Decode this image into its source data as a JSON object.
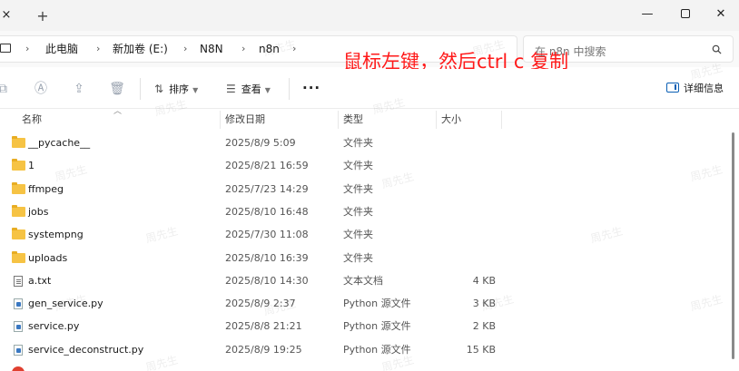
{
  "window": {
    "close_tab_glyph": "×",
    "new_tab_glyph": "+",
    "minimize_glyph": "—",
    "close_glyph": "✕"
  },
  "address": {
    "breadcrumbs": [
      "此电脑",
      "新加卷 (E:)",
      "N8N",
      "n8n"
    ],
    "separator": "›"
  },
  "search": {
    "placeholder": "在 n8n 中搜索"
  },
  "annotation": {
    "text": "鼠标左键，然后ctrl c 复制",
    "color": "#ff1a1a"
  },
  "toolbar": {
    "sort_label": "排序",
    "view_label": "查看",
    "more_label": "···",
    "details_label": "详细信息"
  },
  "columns": {
    "name": "名称",
    "date": "修改日期",
    "type": "类型",
    "size": "大小"
  },
  "files": [
    {
      "icon": "folder-icon",
      "name": "__pycache__",
      "date": "2025/8/9 5:09",
      "type": "文件夹",
      "size": ""
    },
    {
      "icon": "folder-icon",
      "name": "1",
      "date": "2025/8/21 16:59",
      "type": "文件夹",
      "size": ""
    },
    {
      "icon": "folder-icon",
      "name": "ffmpeg",
      "date": "2025/7/23 14:29",
      "type": "文件夹",
      "size": ""
    },
    {
      "icon": "folder-icon",
      "name": "jobs",
      "date": "2025/8/10 16:48",
      "type": "文件夹",
      "size": ""
    },
    {
      "icon": "folder-icon",
      "name": "systempng",
      "date": "2025/7/30 11:08",
      "type": "文件夹",
      "size": ""
    },
    {
      "icon": "folder-icon",
      "name": "uploads",
      "date": "2025/8/10 16:39",
      "type": "文件夹",
      "size": ""
    },
    {
      "icon": "text-file-icon",
      "name": "a.txt",
      "date": "2025/8/10 14:30",
      "type": "文本文档",
      "size": "4 KB"
    },
    {
      "icon": "python-file-icon",
      "name": "gen_service.py",
      "date": "2025/8/9 2:37",
      "type": "Python 源文件",
      "size": "3 KB"
    },
    {
      "icon": "python-file-icon",
      "name": "service.py",
      "date": "2025/8/8 21:21",
      "type": "Python 源文件",
      "size": "2 KB"
    },
    {
      "icon": "python-file-icon",
      "name": "service_deconstruct.py",
      "date": "2025/8/9 19:25",
      "type": "Python 源文件",
      "size": "15 KB"
    }
  ],
  "colors": {
    "folder": "#f6c344",
    "accent": "#0a5fb4",
    "titlebar": "#f3f3f3"
  }
}
